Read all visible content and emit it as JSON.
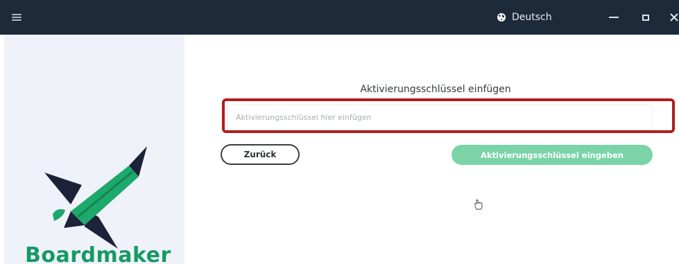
{
  "titlebar": {
    "menu_icon": "hamburger-icon",
    "language_icon": "globe-icon",
    "language_label": "Deutsch",
    "minimize_icon": "minimize-icon",
    "maximize_icon": "maximize-icon",
    "close_icon": "close-icon"
  },
  "sidebar": {
    "logo_icon": "pencil-rocket-logo",
    "brand": "Boardmaker"
  },
  "activation": {
    "title": "Aktivierungsschlüssel einfügen",
    "input_value": "",
    "input_placeholder": "Aktivierungsschlüssel hier einfügen",
    "back_label": "Zurück",
    "submit_label": "Aktivierungsschlüssel eingeben"
  },
  "colors": {
    "titlebar_bg": "#1c2a3a",
    "sidebar_bg": "#eff2f9",
    "brand_green": "#179a63",
    "submit_bg": "#7ad4a8",
    "highlight_red": "#b21d1d"
  }
}
